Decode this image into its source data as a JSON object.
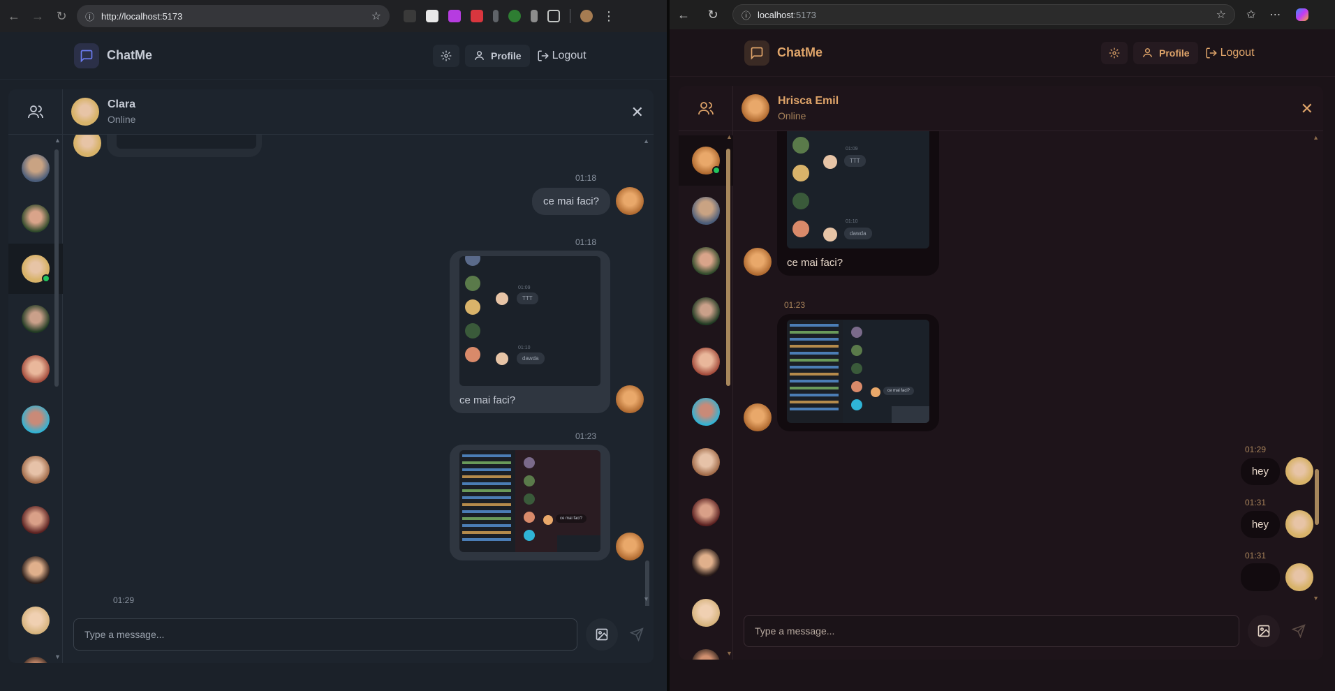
{
  "left": {
    "browser": {
      "url": "http://localhost:5173"
    },
    "app": {
      "title": "ChatMe",
      "profile_label": "Profile",
      "logout_label": "Logout"
    },
    "chat": {
      "name": "Clara",
      "status": "Online"
    },
    "messages": [
      {
        "time": "01:18",
        "text": "ce mai faci?"
      },
      {
        "time": "01:18",
        "text": "ce mai faci?",
        "preview_times": [
          "01:09",
          "01:10"
        ],
        "preview_texts": [
          "TTT",
          "dawda"
        ]
      },
      {
        "time": "01:23",
        "preview_texts": [
          "ce mai faci?"
        ]
      },
      {
        "time": "01:29"
      }
    ],
    "input": {
      "placeholder": "Type a message..."
    }
  },
  "right": {
    "browser": {
      "url_host": "localhost",
      "url_port": ":5173"
    },
    "app": {
      "title": "ChatMe",
      "profile_label": "Profile",
      "logout_label": "Logout"
    },
    "chat": {
      "name": "Hrisca Emil",
      "status": "Online"
    },
    "messages": [
      {
        "text": "ce mai faci?",
        "preview_times": [
          "01:09",
          "01:10"
        ],
        "preview_texts": [
          "TTT",
          "dawda"
        ]
      },
      {
        "time": "01:23",
        "preview_texts": [
          "ce mai faci?"
        ]
      },
      {
        "time": "01:29",
        "text": "hey"
      },
      {
        "time": "01:31",
        "text": "hey"
      },
      {
        "time": "01:31"
      }
    ],
    "input": {
      "placeholder": "Type a message..."
    }
  },
  "theme": {
    "left_accent": "#6c7cf2",
    "left_text": "#c7ccd6",
    "right_accent": "#e0a56a",
    "online": "#22c55e"
  }
}
